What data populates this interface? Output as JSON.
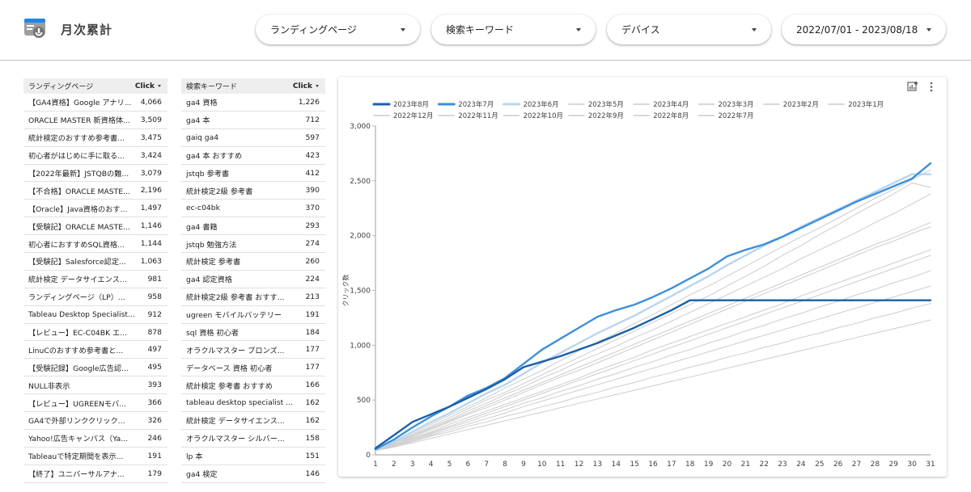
{
  "header": {
    "title": "月次累計",
    "filters": [
      {
        "label": "ランディングページ"
      },
      {
        "label": "検索キーワード"
      },
      {
        "label": "デバイス"
      },
      {
        "label": "2022/07/01 - 2023/08/18"
      }
    ]
  },
  "landing_table": {
    "col_label": "ランディングページ",
    "col_metric": "Click",
    "rows": [
      {
        "label": "【GA4資格】Google アナリ...",
        "value": "4,066"
      },
      {
        "label": "ORACLE MASTER 新資格体...",
        "value": "3,509"
      },
      {
        "label": "統計検定のおすすめ参考書...",
        "value": "3,475"
      },
      {
        "label": "初心者がはじめに手に取る...",
        "value": "3,424"
      },
      {
        "label": "【2022年最新】JSTQBの難...",
        "value": "3,079"
      },
      {
        "label": "【不合格】ORACLE MASTE...",
        "value": "2,196"
      },
      {
        "label": "【Oracle】Java資格のおす...",
        "value": "1,497"
      },
      {
        "label": "【受験記】ORACLE MASTE...",
        "value": "1,146"
      },
      {
        "label": "初心者におすすめSQL資格...",
        "value": "1,144"
      },
      {
        "label": "【受験記】Salesforce認定...",
        "value": "1,063"
      },
      {
        "label": "統計検定 データサイエンス...",
        "value": "981"
      },
      {
        "label": "ランディングページ（LP）...",
        "value": "958"
      },
      {
        "label": "Tableau Desktop Specialist...",
        "value": "912"
      },
      {
        "label": "【レビュー】EC-C04BK エ...",
        "value": "878"
      },
      {
        "label": "LinuCのおすすめ参考書と...",
        "value": "497"
      },
      {
        "label": "【受験記録】Google広告認...",
        "value": "495"
      },
      {
        "label": "NULL非表示",
        "value": "393"
      },
      {
        "label": "【レビュー】UGREENモバ...",
        "value": "366"
      },
      {
        "label": "GA4で外部リンククリック...",
        "value": "326"
      },
      {
        "label": "Yahoo!広告キャンパス（Ya...",
        "value": "246"
      },
      {
        "label": "Tableauで特定期間を表示...",
        "value": "191"
      },
      {
        "label": "【終了】ユニバーサルアナ...",
        "value": "179"
      }
    ]
  },
  "keyword_table": {
    "col_label": "検索キーワード",
    "col_metric": "Click",
    "rows": [
      {
        "label": "ga4 資格",
        "value": "1,226"
      },
      {
        "label": "ga4 本",
        "value": "712"
      },
      {
        "label": "gaiq ga4",
        "value": "597"
      },
      {
        "label": "ga4 本 おすすめ",
        "value": "423"
      },
      {
        "label": "jstqb 参考書",
        "value": "412"
      },
      {
        "label": "統計検定2級 参考書",
        "value": "390"
      },
      {
        "label": "ec-c04bk",
        "value": "370"
      },
      {
        "label": "ga4 書籍",
        "value": "293"
      },
      {
        "label": "jstqb 勉強方法",
        "value": "274"
      },
      {
        "label": "統計検定 参考書",
        "value": "260"
      },
      {
        "label": "ga4 認定資格",
        "value": "224"
      },
      {
        "label": "統計検定2級 参考書 おすす...",
        "value": "213"
      },
      {
        "label": "ugreen モバイルバッテリー",
        "value": "191"
      },
      {
        "label": "sql 資格 初心者",
        "value": "184"
      },
      {
        "label": "オラクルマスター ブロンズ...",
        "value": "177"
      },
      {
        "label": "データベース 資格 初心者",
        "value": "177"
      },
      {
        "label": "統計検定 参考書 おすすめ",
        "value": "166"
      },
      {
        "label": "tableau desktop specialist ...",
        "value": "162"
      },
      {
        "label": "統計検定 データサイエンス...",
        "value": "162"
      },
      {
        "label": "オラクルマスター シルバー...",
        "value": "158"
      },
      {
        "label": "lp 本",
        "value": "151"
      },
      {
        "label": "ga4 検定",
        "value": "146"
      }
    ]
  },
  "card_icons": [
    "chart-settings-icon",
    "more-vert-icon"
  ],
  "chart_data": {
    "type": "line",
    "ylabel": "クリック数",
    "xlabel": "",
    "ylim": [
      0,
      3000
    ],
    "yticks": [
      "0",
      "500",
      "1,000",
      "1,500",
      "2,000",
      "2,500",
      "3,000"
    ],
    "x": [
      1,
      2,
      3,
      4,
      5,
      6,
      7,
      8,
      9,
      10,
      11,
      12,
      13,
      14,
      15,
      16,
      17,
      18,
      19,
      20,
      21,
      22,
      23,
      24,
      25,
      26,
      27,
      28,
      29,
      30,
      31
    ],
    "series": [
      {
        "name": "2023年8月",
        "color": "#1a5fa8",
        "width": 2.4,
        "values": [
          60,
          180,
          300,
          370,
          440,
          520,
          600,
          690,
          800,
          850,
          900,
          960,
          1020,
          1090,
          1160,
          1240,
          1320,
          1410,
          1410,
          1410,
          1410,
          1410,
          1410,
          1410,
          1410,
          1410,
          1410,
          1410,
          1410,
          1410,
          1410
        ]
      },
      {
        "name": "2023年7月",
        "color": "#3d8fdb",
        "width": 2.4,
        "values": [
          50,
          140,
          250,
          350,
          440,
          540,
          610,
          700,
          830,
          960,
          1060,
          1160,
          1260,
          1320,
          1370,
          1440,
          1520,
          1610,
          1700,
          1810,
          1870,
          1920,
          1990,
          2070,
          2150,
          2230,
          2310,
          2380,
          2450,
          2520,
          2660
        ]
      },
      {
        "name": "2023年6月",
        "color": "#b8d5f0",
        "width": 2.4,
        "values": [
          40,
          120,
          210,
          300,
          380,
          470,
          560,
          640,
          740,
          840,
          930,
          1020,
          1110,
          1190,
          1270,
          1360,
          1450,
          1540,
          1630,
          1730,
          1820,
          1910,
          1990,
          2080,
          2160,
          2240,
          2320,
          2400,
          2480,
          2560,
          2560
        ]
      },
      {
        "name": "2023年5月",
        "color": "#cccccc",
        "width": 1,
        "values": [
          40,
          110,
          190,
          280,
          360,
          440,
          520,
          610,
          690,
          770,
          860,
          950,
          1030,
          1110,
          1200,
          1280,
          1370,
          1460,
          1540,
          1630,
          1720,
          1810,
          1900,
          1990,
          2070,
          2160,
          2250,
          2340,
          2420,
          2510,
          2600
        ]
      },
      {
        "name": "2023年4月",
        "color": "#cccccc",
        "width": 1,
        "values": [
          40,
          110,
          180,
          260,
          340,
          420,
          500,
          570,
          650,
          730,
          810,
          890,
          970,
          1050,
          1130,
          1210,
          1290,
          1370,
          1450,
          1540,
          1630,
          1720,
          1820,
          1910,
          2010,
          2100,
          2200,
          2290,
          2380,
          2480,
          2440
        ]
      },
      {
        "name": "2023年3月",
        "color": "#cccccc",
        "width": 1,
        "values": [
          40,
          100,
          170,
          250,
          320,
          400,
          470,
          550,
          620,
          700,
          770,
          850,
          920,
          990,
          1070,
          1140,
          1220,
          1300,
          1380,
          1460,
          1540,
          1620,
          1700,
          1790,
          1870,
          1950,
          2030,
          2120,
          2200,
          2290,
          2380
        ]
      },
      {
        "name": "2023年2月",
        "color": "#cccccc",
        "width": 1,
        "values": [
          40,
          100,
          170,
          240,
          310,
          380,
          450,
          520,
          590,
          660,
          730,
          800,
          870,
          940,
          1010,
          1080,
          1150,
          1220,
          1290,
          1360,
          1430,
          1500,
          1570,
          1640,
          1710,
          1780,
          1850,
          1920,
          1980,
          2050,
          2120
        ]
      },
      {
        "name": "2023年1月",
        "color": "#cccccc",
        "width": 1,
        "values": [
          40,
          90,
          160,
          230,
          300,
          370,
          430,
          500,
          570,
          640,
          710,
          770,
          840,
          910,
          980,
          1050,
          1120,
          1190,
          1260,
          1330,
          1400,
          1470,
          1540,
          1610,
          1680,
          1750,
          1820,
          1890,
          1950,
          2020,
          2080
        ]
      },
      {
        "name": "2022年12月",
        "color": "#cccccc",
        "width": 1,
        "values": [
          40,
          90,
          150,
          210,
          280,
          340,
          400,
          460,
          520,
          580,
          640,
          700,
          770,
          830,
          890,
          960,
          1020,
          1080,
          1140,
          1200,
          1260,
          1320,
          1380,
          1450,
          1510,
          1570,
          1630,
          1690,
          1750,
          1810,
          1870
        ]
      },
      {
        "name": "2022年11月",
        "color": "#cccccc",
        "width": 1,
        "values": [
          40,
          90,
          150,
          200,
          260,
          320,
          380,
          440,
          500,
          560,
          620,
          680,
          740,
          800,
          860,
          920,
          980,
          1040,
          1100,
          1160,
          1220,
          1280,
          1340,
          1400,
          1460,
          1520,
          1580,
          1640,
          1700,
          1760,
          1820
        ]
      },
      {
        "name": "2022年10月",
        "color": "#cccccc",
        "width": 1,
        "values": [
          40,
          80,
          140,
          190,
          250,
          300,
          360,
          410,
          470,
          520,
          580,
          630,
          690,
          740,
          800,
          850,
          910,
          960,
          1020,
          1070,
          1130,
          1180,
          1240,
          1290,
          1350,
          1400,
          1460,
          1510,
          1570,
          1620,
          1680
        ]
      },
      {
        "name": "2022年9月",
        "color": "#cccccc",
        "width": 1,
        "values": [
          40,
          80,
          130,
          180,
          230,
          280,
          330,
          380,
          440,
          490,
          540,
          590,
          640,
          690,
          740,
          790,
          840,
          890,
          940,
          990,
          1040,
          1090,
          1140,
          1190,
          1240,
          1290,
          1340,
          1390,
          1440,
          1490,
          1540
        ]
      },
      {
        "name": "2022年8月",
        "color": "#cccccc",
        "width": 1,
        "values": [
          40,
          80,
          120,
          170,
          210,
          260,
          300,
          350,
          390,
          440,
          480,
          530,
          570,
          620,
          660,
          710,
          750,
          800,
          840,
          890,
          930,
          980,
          1020,
          1070,
          1110,
          1160,
          1200,
          1250,
          1290,
          1340,
          1380
        ]
      },
      {
        "name": "2022年7月",
        "color": "#cccccc",
        "width": 1,
        "values": [
          40,
          70,
          110,
          150,
          190,
          230,
          270,
          310,
          350,
          390,
          430,
          470,
          510,
          550,
          590,
          630,
          670,
          710,
          750,
          790,
          830,
          870,
          910,
          950,
          990,
          1030,
          1070,
          1110,
          1150,
          1190,
          1230
        ]
      }
    ]
  }
}
